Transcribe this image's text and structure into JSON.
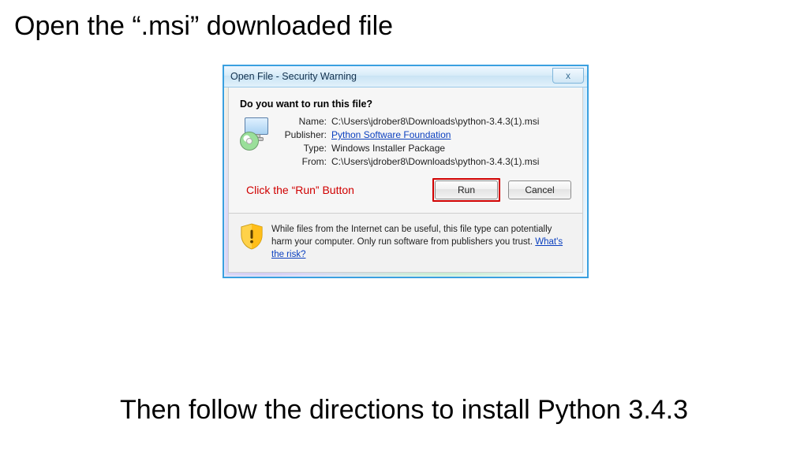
{
  "slide": {
    "heading": "Open the “.msi” downloaded file",
    "footer": "Then follow the directions to install Python 3.4.3",
    "annotation": "Click the “Run” Button"
  },
  "dialog": {
    "title": "Open File - Security Warning",
    "close_label": "x",
    "prompt": "Do you want to run this file?",
    "fields": {
      "name_label": "Name:",
      "name_value": "C:\\Users\\jdrober8\\Downloads\\python-3.4.3(1).msi",
      "publisher_label": "Publisher:",
      "publisher_value": "Python Software Foundation",
      "type_label": "Type:",
      "type_value": "Windows Installer Package",
      "from_label": "From:",
      "from_value": "C:\\Users\\jdrober8\\Downloads\\python-3.4.3(1).msi"
    },
    "buttons": {
      "run": "Run",
      "cancel": "Cancel"
    },
    "warning_text": "While files from the Internet can be useful, this file type can potentially harm your computer. Only run software from publishers you trust.",
    "warning_link": "What's the risk?"
  }
}
